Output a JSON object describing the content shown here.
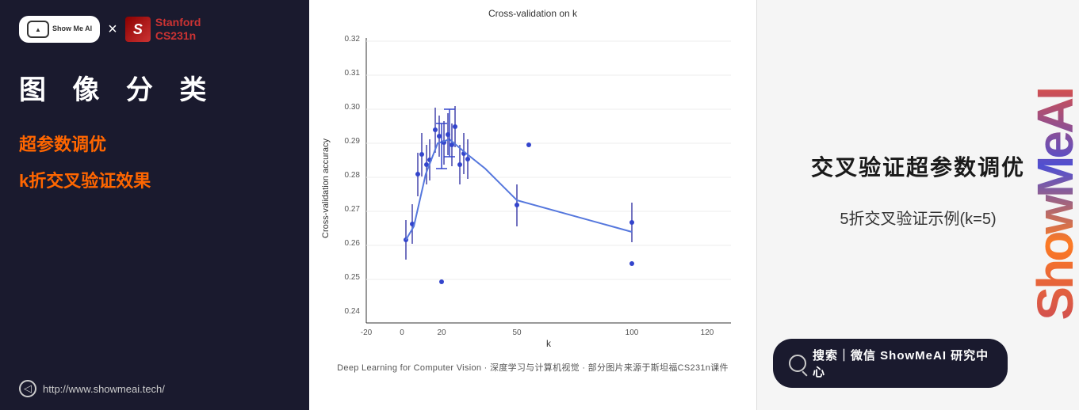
{
  "left": {
    "showme_label": "Show Me Al",
    "x_symbol": "×",
    "stanford_label": "Stanford\nCS231n",
    "page_title": "图 像 分 类",
    "section1": "超参数调优",
    "section2": "k折交叉验证效果",
    "website": "http://www.showmeai.tech/"
  },
  "chart": {
    "title": "Cross-validation on k",
    "x_label": "k",
    "y_label": "Cross-validation accuracy",
    "footer": "Deep Learning for Computer Vision · 深度学习与计算机视觉 · 部分图片来源于斯坦福CS231n课件"
  },
  "right": {
    "main_heading": "交叉验证超参数调优",
    "sub_heading": "5折交叉验证示例(k=5)",
    "watermark": "ShowMeAI",
    "search_text": "搜索｜微信  ShowMeAI 研究中心"
  },
  "icons": {
    "search": "🔍",
    "nav": "◁"
  }
}
